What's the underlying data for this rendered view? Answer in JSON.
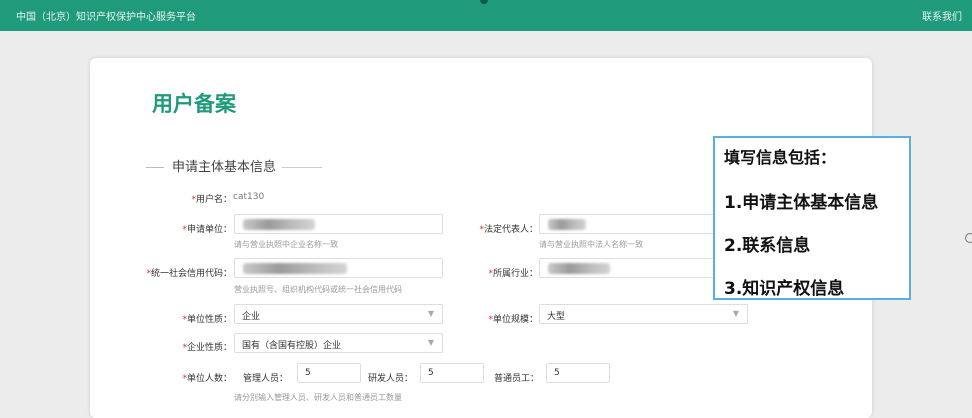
{
  "topbar": {
    "site_title": "中国（北京）知识产权保护中心服务平台",
    "contact": "联系我们"
  },
  "page": {
    "title": "用户备案"
  },
  "section": {
    "title": "申请主体基本信息"
  },
  "form": {
    "username": {
      "label": "用户名：",
      "value": "cat130"
    },
    "company": {
      "label": "申请单位：",
      "hint": "请与营业执照中企业名称一致"
    },
    "legal_rep": {
      "label": "法定代表人：",
      "hint": "请与营业执照中法人名称一致"
    },
    "credit_code": {
      "label": "统一社会信用代码：",
      "hint": "营业执照号、组织机构代码或统一社会信用代码"
    },
    "industry": {
      "label": "所属行业："
    },
    "unit_nature": {
      "label": "单位性质：",
      "value": "企业"
    },
    "unit_scale": {
      "label": "单位规模：",
      "value": "大型"
    },
    "enterprise_nature": {
      "label": "企业性质：",
      "value": "国有（含国有控股）企业"
    },
    "headcount": {
      "label": "单位人数：",
      "managers_label": "管理人员：",
      "managers_value": "5",
      "rd_label": "研发人员：",
      "rd_value": "5",
      "staff_label": "普通员工：",
      "staff_value": "5",
      "hint": "请分别输入管理人员、研发人员和普通员工数量"
    },
    "required_mark": "*"
  },
  "callout": {
    "heading": "填写信息包括：",
    "items": [
      "1.申请主体基本信息",
      "2.联系信息",
      "3.知识产权信息"
    ]
  }
}
